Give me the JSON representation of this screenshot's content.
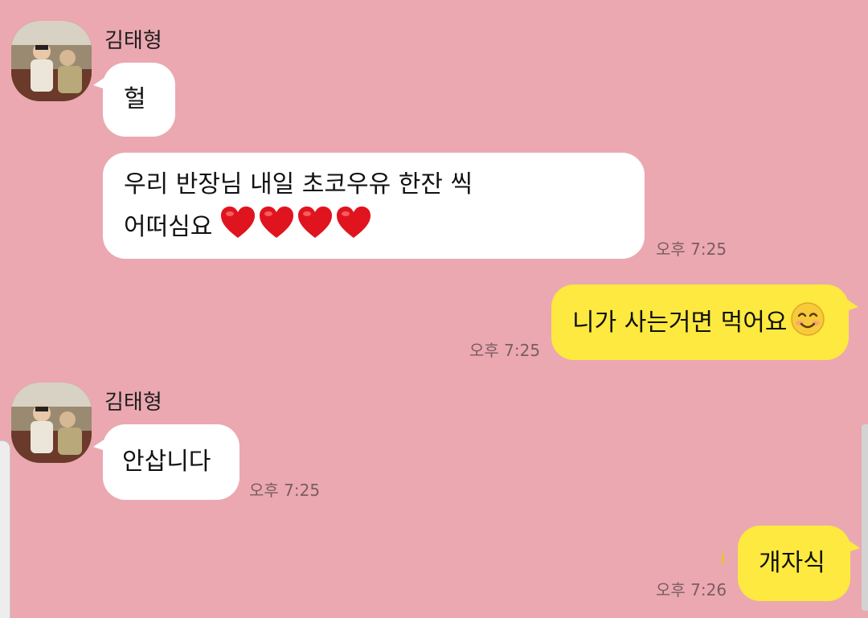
{
  "messages": [
    {
      "sender": "김태형",
      "avatar_icon": "profile-photo",
      "bubbles": [
        {
          "text": "헐"
        },
        {
          "line1": "우리 반장님 내일 초코우유 한잔 씩",
          "line2": "어떠심요",
          "emoji": "heart x4",
          "time": "오후 7:25"
        }
      ]
    },
    {
      "mine": true,
      "text": "니가 사는거면 먹어요",
      "emoji": "smiling-face",
      "time": "오후 7:25"
    },
    {
      "sender": "김태형",
      "avatar_icon": "profile-photo",
      "bubbles": [
        {
          "text": "안삽니다",
          "time": "오후 7:25"
        }
      ]
    },
    {
      "mine": true,
      "text": "개자식",
      "time": "오후 7:26"
    }
  ],
  "colors": {
    "background": "#eba8b1",
    "incoming_bubble": "#ffffff",
    "outgoing_bubble": "#fde93f",
    "heart": "#e0141e",
    "timestamp": "#7a5d62"
  }
}
